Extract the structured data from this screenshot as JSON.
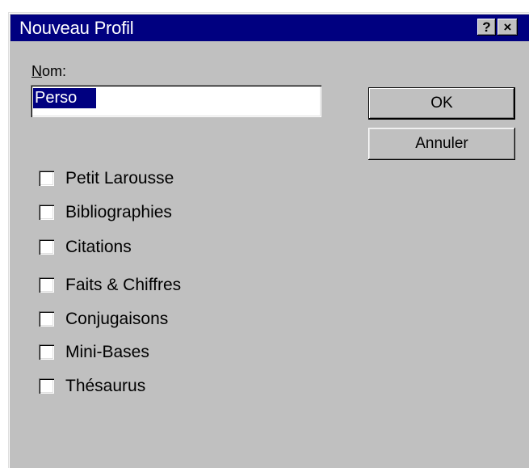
{
  "window": {
    "title": "Nouveau Profil",
    "help_glyph": "?",
    "close_glyph": "×"
  },
  "form": {
    "name_label_mnemonic": "N",
    "name_label_rest": "om:",
    "name_value": "Perso"
  },
  "buttons": {
    "ok_label": "OK",
    "cancel_label": "Annuler"
  },
  "checkboxes": [
    {
      "label": "Petit Larousse",
      "checked": false
    },
    {
      "label": "Bibliographies",
      "checked": false
    },
    {
      "label": "Citations",
      "checked": false
    },
    {
      "label": "Faits & Chiffres",
      "checked": false
    },
    {
      "label": "Conjugaisons",
      "checked": false
    },
    {
      "label": "Mini-Bases",
      "checked": false
    },
    {
      "label": "Thésaurus",
      "checked": false
    }
  ],
  "colors": {
    "titlebar": "#000080",
    "face": "#c0c0c0",
    "selection": "#000080"
  }
}
